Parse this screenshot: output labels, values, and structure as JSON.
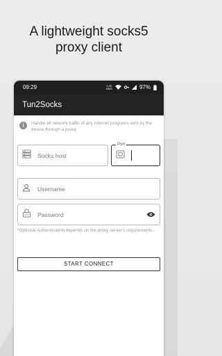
{
  "headline": {
    "line1": "A lightweight socks5",
    "line2": "proxy client"
  },
  "statusbar": {
    "time": "09:29",
    "data_rate_top": "0.00",
    "data_rate_bottom": "KB/S",
    "battery": "97%"
  },
  "appbar": {
    "title": "Tun2Socks"
  },
  "info": {
    "icon": "info-icon",
    "text": "Handle all network traffic of any internet programs sent by the device through a proxy."
  },
  "form": {
    "host": {
      "placeholder": "Socks host",
      "icon": "server-icon"
    },
    "port": {
      "label": "Port",
      "icon": "ethernet-port-icon"
    },
    "username": {
      "placeholder": "Username",
      "icon": "person-icon"
    },
    "password": {
      "placeholder": "Password",
      "icon": "lock-icon",
      "toggle_icon": "eye-icon"
    },
    "note": "*Optional Authentication depends on the proxy server's requirements.",
    "connect_label": "START CONNECT"
  },
  "colors": {
    "appbar": "#232323",
    "statusbar": "#1e1e1e",
    "background": "#ececec",
    "hint_text": "#9a9a9a"
  }
}
